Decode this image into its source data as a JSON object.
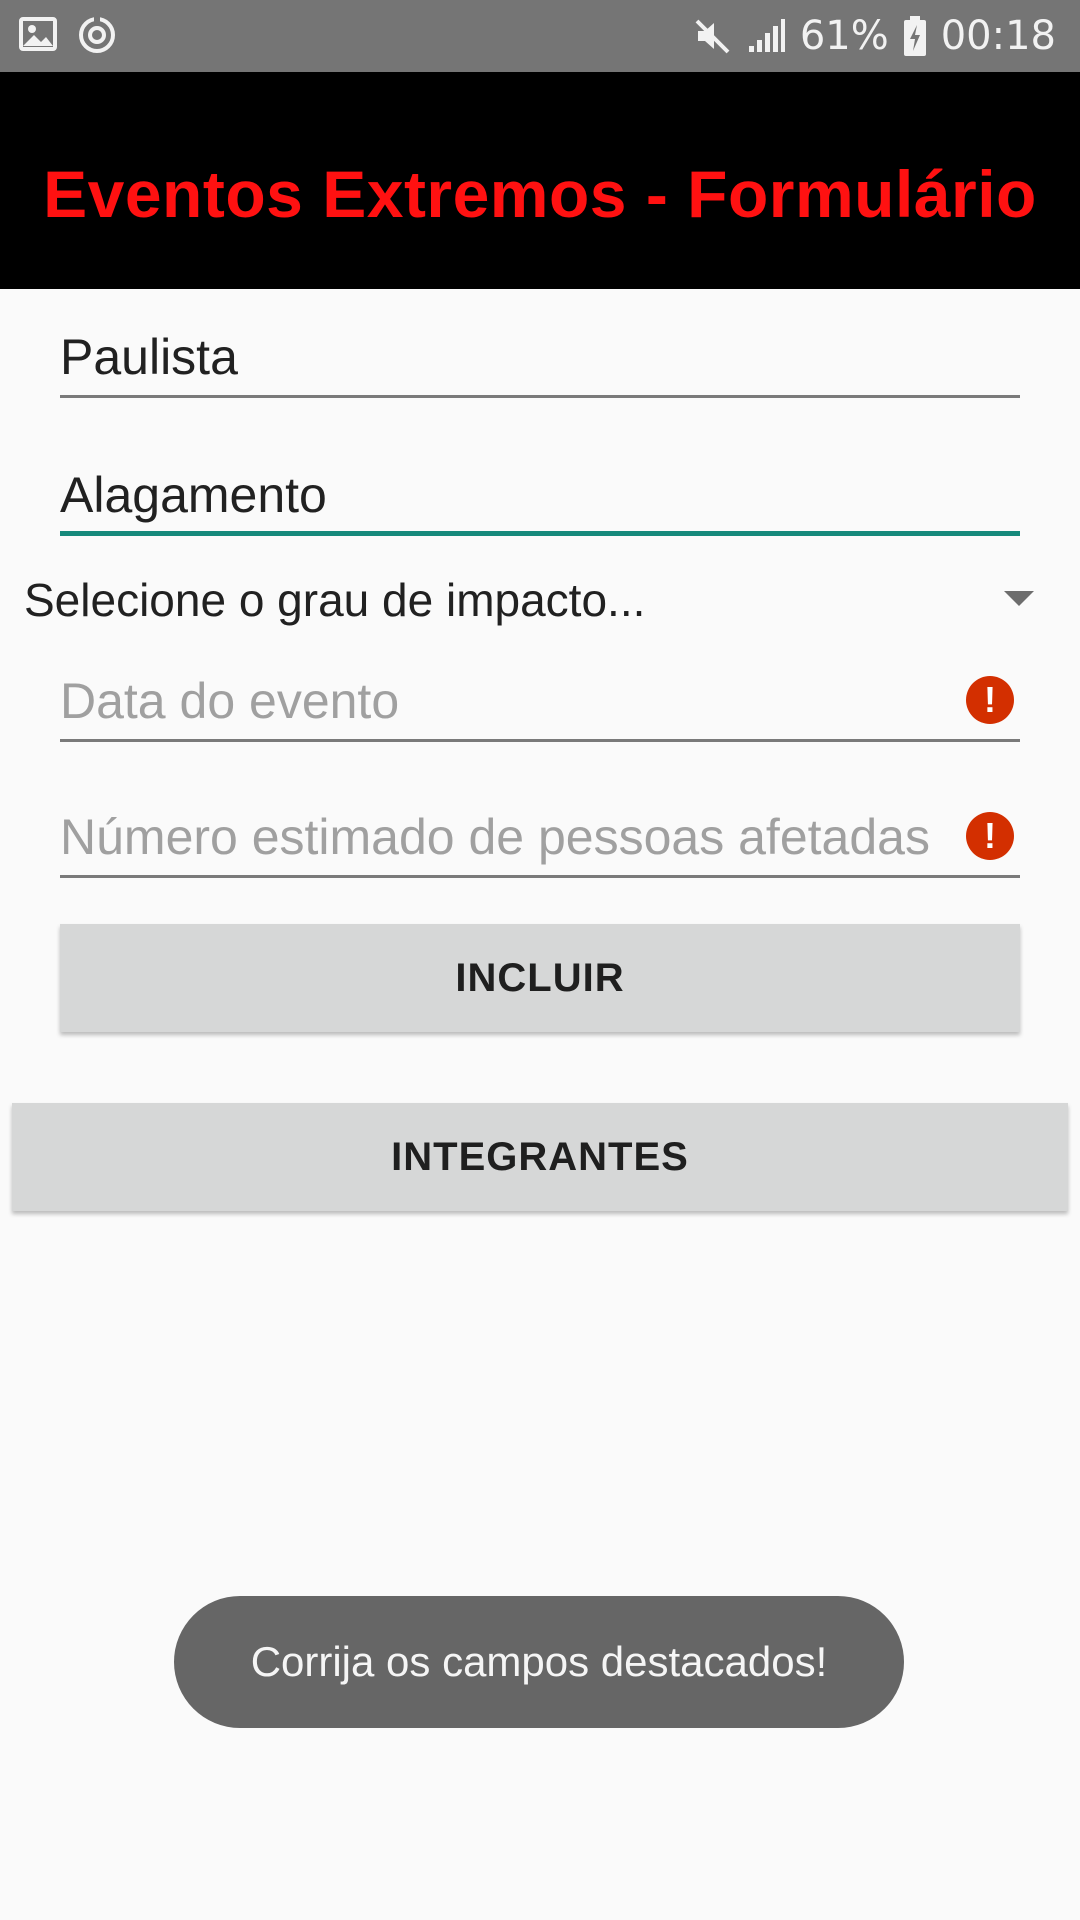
{
  "status_bar": {
    "left_icons": [
      "gallery-icon",
      "sync-icon"
    ],
    "battery_percent": "61%",
    "time": "00:18",
    "right_icons": [
      "mute-icon",
      "signal-icon",
      "battery-charging-icon"
    ]
  },
  "header": {
    "title": "Eventos Extremos - Formulário",
    "title_color": "#ff1111",
    "background": "#000000"
  },
  "form": {
    "field1_value": "Paulista",
    "field2_value": "Alagamento",
    "impact_spinner_value": "Selecione o grau de impacto...",
    "date_placeholder": "Data do evento",
    "people_placeholder": "Número estimado de pessoas afetadas",
    "include_button": "INCLUIR",
    "members_button": "INTEGRANTES",
    "accent_color": "#16897b",
    "error_color": "#d32f00"
  },
  "toast": {
    "message": "Corrija os campos destacados!"
  }
}
